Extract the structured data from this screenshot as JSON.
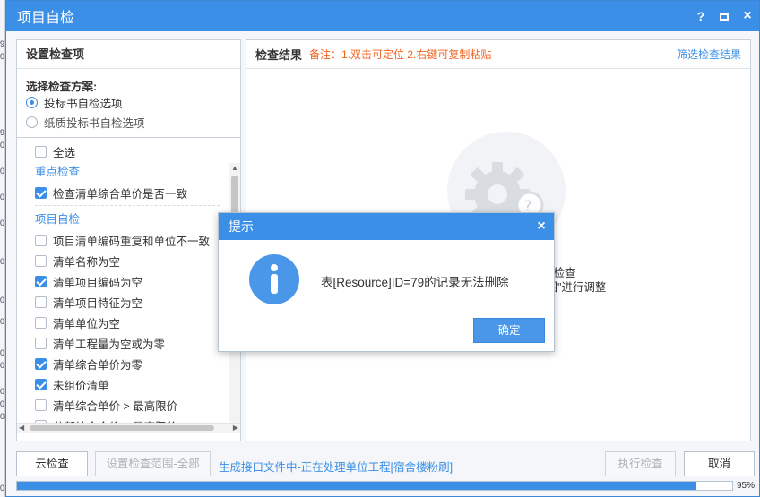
{
  "gutter_numbers": [
    "9",
    "0",
    "9",
    "0",
    "0",
    "0",
    "0",
    "0",
    "0",
    "0",
    "0",
    "0",
    "0",
    "0",
    "08",
    "0"
  ],
  "window": {
    "title": "项目自检",
    "help": "?",
    "close": "×"
  },
  "left_panel": {
    "header": "设置检查项",
    "scheme_title": "选择检查方案:",
    "schemes": [
      {
        "label": "投标书自检选项",
        "selected": true
      },
      {
        "label": "纸质投标书自检选项",
        "selected": false
      }
    ],
    "select_all": {
      "label": "全选",
      "checked": false
    },
    "groups": [
      {
        "title": "重点检查",
        "items": [
          {
            "label": "检查清单综合单价是否一致",
            "checked": true
          }
        ]
      },
      {
        "title": "项目自检",
        "items": [
          {
            "label": "项目清单编码重复和单位不一致",
            "checked": false
          },
          {
            "label": "清单名称为空",
            "checked": false
          },
          {
            "label": "清单项目编码为空",
            "checked": true
          },
          {
            "label": "清单项目特征为空",
            "checked": false
          },
          {
            "label": "清单单位为空",
            "checked": false
          },
          {
            "label": "清单工程量为空或为零",
            "checked": false
          },
          {
            "label": "清单综合单价为零",
            "checked": true
          },
          {
            "label": "未组价清单",
            "checked": true
          },
          {
            "label": "清单综合单价 > 最高限价",
            "checked": false
          },
          {
            "label": "分部综合合价 > 最高限价",
            "checked": false
          }
        ]
      }
    ]
  },
  "right_panel": {
    "header": "检查结果",
    "note": "备注：1.双击可定位 2.右键可复制粘贴",
    "filter_link": "筛选检查结果",
    "empty_line1": "项检查",
    "empty_line2": "范围\"进行调整"
  },
  "dialog": {
    "title": "提示",
    "close": "×",
    "message": "表[Resource]ID=79的记录无法删除",
    "ok": "确定"
  },
  "footer": {
    "cloud_check": "云检查",
    "set_range": "设置检查范围-全部",
    "status": "生成接口文件中-正在处理单位工程[宿舍楼粉刷]",
    "run_check": "执行检查",
    "cancel": "取消"
  },
  "progress": {
    "value": 0.95,
    "label": "95%"
  },
  "colors": {
    "accent": "#3b8fe6",
    "note": "#f26522"
  }
}
